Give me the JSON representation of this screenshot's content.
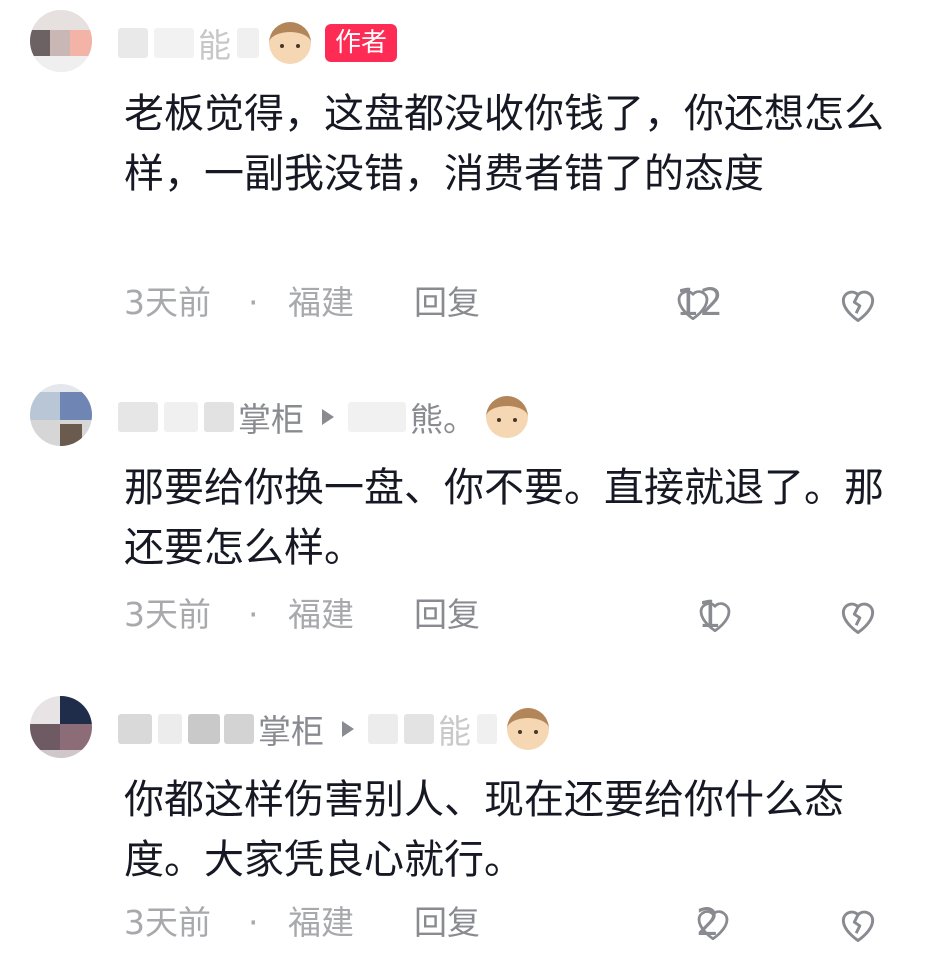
{
  "comments": [
    {
      "name_visible": "能",
      "is_author": true,
      "author_tag": "作者",
      "text": "老板觉得，这盘都没收你钱了，你还想怎么样，一副我没错，消费者错了的态度",
      "time": "3天前",
      "sep": "·",
      "location": "福建",
      "reply_label": "回复",
      "likes": "12"
    },
    {
      "name_visible": "掌柜",
      "reply_to_visible": "熊。",
      "text": "那要给你换一盘、你不要。直接就退了。那还要怎么样。",
      "time": "3天前",
      "sep": "·",
      "location": "福建",
      "reply_label": "回复",
      "likes": "1"
    },
    {
      "name_visible": "掌柜",
      "reply_to_visible": "能",
      "text": "你都这样伤害别人、现在还要给你什么态度。大家凭良心就行。",
      "time": "3天前",
      "sep": "·",
      "location": "福建",
      "reply_label": "回复",
      "likes": "2"
    }
  ],
  "icons": {
    "like": "heart-outline-icon",
    "dislike": "broken-heart-icon",
    "reply_arrow": "triangle-right-icon",
    "user_emoji": "boy-face-emoji-icon"
  },
  "colors": {
    "author_tag_bg": "#fe2c55",
    "text": "#161823",
    "muted": "#a8a9ad"
  }
}
